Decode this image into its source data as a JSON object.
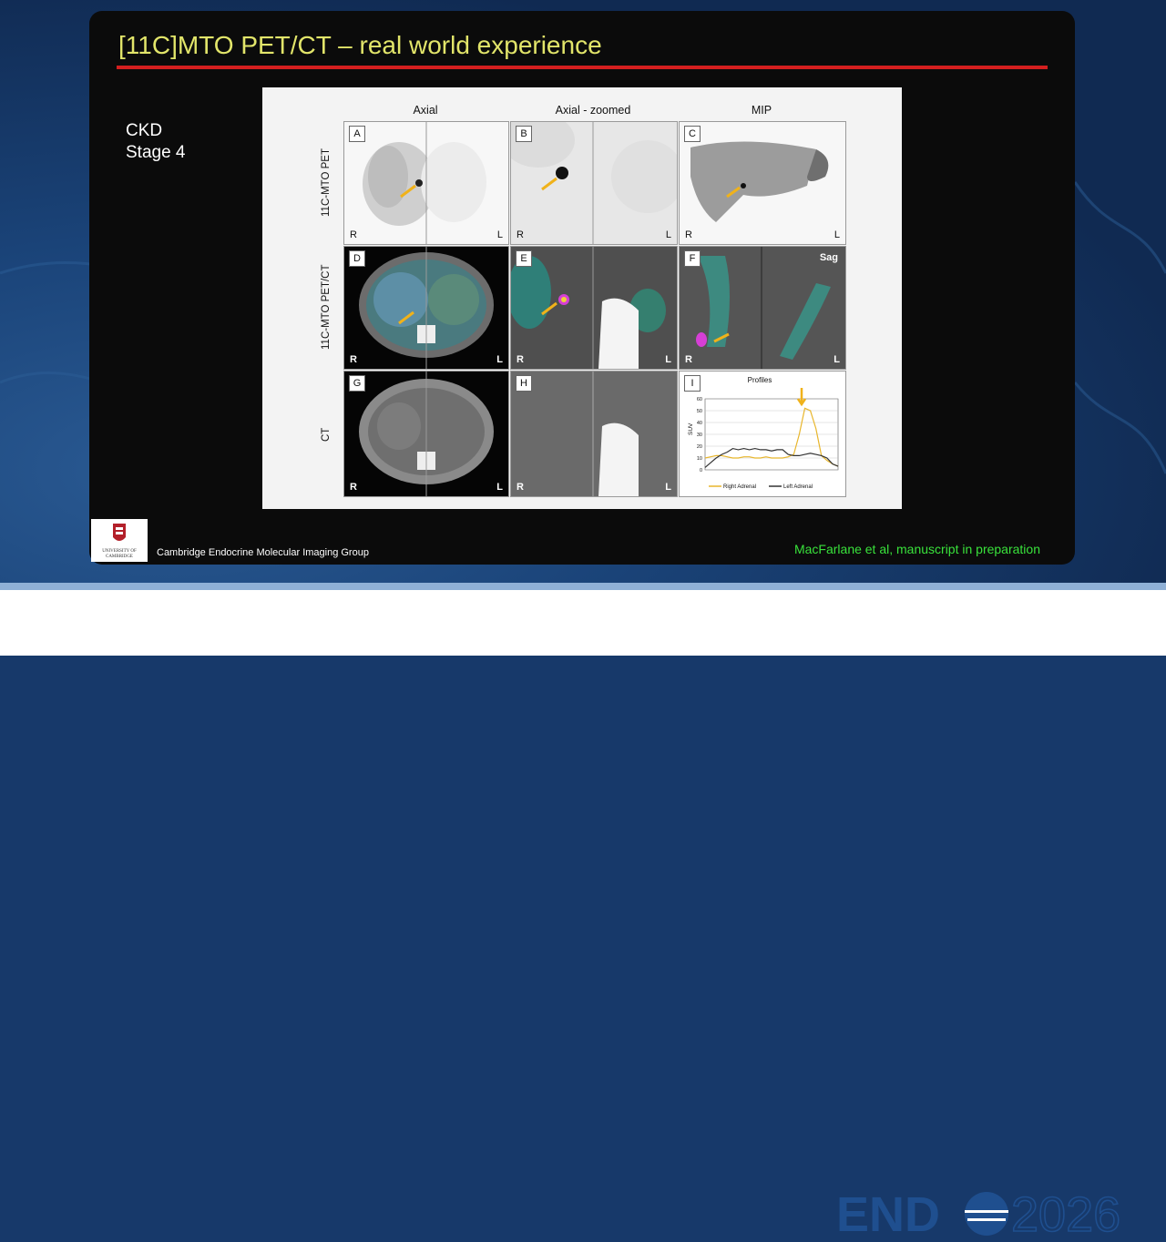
{
  "slide": {
    "title": "[11C]MTO PET/CT – real world experience",
    "side_note": [
      "CKD",
      "Stage 4"
    ],
    "footer_left": "Cambridge Endocrine Molecular Imaging Group",
    "footer_right": "MacFarlane et al, manuscript in preparation",
    "university_logo_text": [
      "UNIVERSITY OF",
      "CAMBRIDGE"
    ]
  },
  "figure": {
    "column_headers": [
      "Axial",
      "Axial - zoomed",
      "MIP"
    ],
    "row_headers": [
      "11C-MTO PET",
      "11C-MTO PET/CT",
      "CT"
    ],
    "panels": [
      {
        "label": "A",
        "left": "R",
        "right": "L"
      },
      {
        "label": "B",
        "left": "R",
        "right": "L"
      },
      {
        "label": "C",
        "left": "R",
        "right": "L"
      },
      {
        "label": "D",
        "left": "R",
        "right": "L"
      },
      {
        "label": "E",
        "left": "R",
        "right": "L"
      },
      {
        "label": "F",
        "left": "R",
        "right": "L",
        "extra": "Sag"
      },
      {
        "label": "G",
        "left": "R",
        "right": "L"
      },
      {
        "label": "H",
        "left": "R",
        "right": "L"
      },
      {
        "label": "I"
      }
    ]
  },
  "chart_data": {
    "type": "line",
    "title": "Profiles",
    "xlabel": "",
    "ylabel": "SUV",
    "ylim": [
      0,
      60
    ],
    "yticks": [
      0,
      10,
      20,
      30,
      40,
      50,
      60
    ],
    "x": [
      0,
      1,
      2,
      3,
      4,
      5,
      6,
      7,
      8,
      9,
      10,
      11,
      12,
      13,
      14,
      15,
      16,
      17,
      18,
      19,
      20,
      21,
      22,
      23,
      24
    ],
    "series": [
      {
        "name": "Right Adrenal",
        "color": "#e8b62c",
        "values": [
          10,
          11,
          12,
          12,
          11,
          10,
          10,
          11,
          11,
          10,
          10,
          11,
          10,
          10,
          10,
          11,
          13,
          30,
          52,
          50,
          35,
          12,
          8,
          5,
          3
        ]
      },
      {
        "name": "Left Adrenal",
        "color": "#333333",
        "values": [
          2,
          6,
          10,
          13,
          15,
          18,
          17,
          18,
          17,
          18,
          17,
          17,
          16,
          17,
          17,
          13,
          12,
          12,
          13,
          14,
          13,
          12,
          10,
          5,
          3
        ]
      }
    ],
    "legend": "bottom"
  },
  "branding": {
    "endo_text_1": "END",
    "endo_text_2": "2026",
    "accent": "#1f4f8f"
  }
}
